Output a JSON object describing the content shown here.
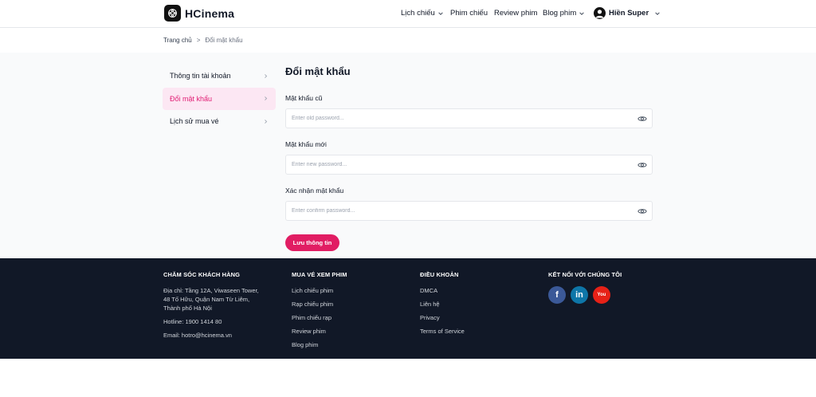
{
  "header": {
    "brand": "HCinema",
    "nav": [
      {
        "label": "Lịch chiếu",
        "dropdown": true
      },
      {
        "label": "Phim chiếu",
        "dropdown": false
      },
      {
        "label": "Review phim",
        "dropdown": false
      },
      {
        "label": "Blog phim",
        "dropdown": true
      }
    ],
    "user_name": "Hiền Super"
  },
  "breadcrumb": {
    "home": "Trang chủ",
    "separator": ">",
    "current": "Đổi mật khẩu"
  },
  "sidebar": {
    "items": [
      {
        "label": "Thông tin tài khoản",
        "active": false
      },
      {
        "label": "Đổi mật khẩu",
        "active": true
      },
      {
        "label": "Lịch sử mua vé",
        "active": false
      }
    ]
  },
  "form": {
    "title": "Đổi mật khẩu",
    "old_password": {
      "label": "Mật khẩu cũ",
      "placeholder": "Enter old password...",
      "value": ""
    },
    "new_password": {
      "label": "Mật khẩu mới",
      "placeholder": "Enter new password...",
      "value": ""
    },
    "confirm_password": {
      "label": "Xác nhận mật khẩu",
      "placeholder": "Enter confirm password...",
      "value": ""
    },
    "submit_label": "Lưu thông tin"
  },
  "footer": {
    "support": {
      "heading": "Chăm sóc khách hàng",
      "address": "Địa chỉ: Tầng 12A, Viwaseen Tower, 48 Tố Hữu, Quận Nam Từ Liêm, Thành phố Hà Nội",
      "hotline": "Hotline: 1900 1414 80",
      "email": "Email: hotro@hcinema.vn"
    },
    "tickets": {
      "heading": "Mua vé xem phim",
      "links": [
        "Lịch chiếu phim",
        "Rạp chiếu phim",
        "Phim chiếu rạp",
        "Review phim",
        "Blog phim"
      ]
    },
    "terms": {
      "heading": "Điều khoản",
      "links": [
        "DMCA",
        "Liên hệ",
        "Privacy",
        "Terms of Service"
      ]
    },
    "connect": {
      "heading": "Kết nối với chúng tôi",
      "socials": [
        {
          "name": "facebook-icon",
          "glyph": "f",
          "color": "#3b5998"
        },
        {
          "name": "linkedin-icon",
          "glyph": "in",
          "color": "#0e76a8"
        },
        {
          "name": "youtube-icon",
          "glyph": "You",
          "color": "#e62117"
        }
      ]
    }
  },
  "colors": {
    "accent": "#e11d63",
    "active_bg": "#fce7f3",
    "footer_bg": "#111827",
    "main_bg": "#f9fafb"
  }
}
